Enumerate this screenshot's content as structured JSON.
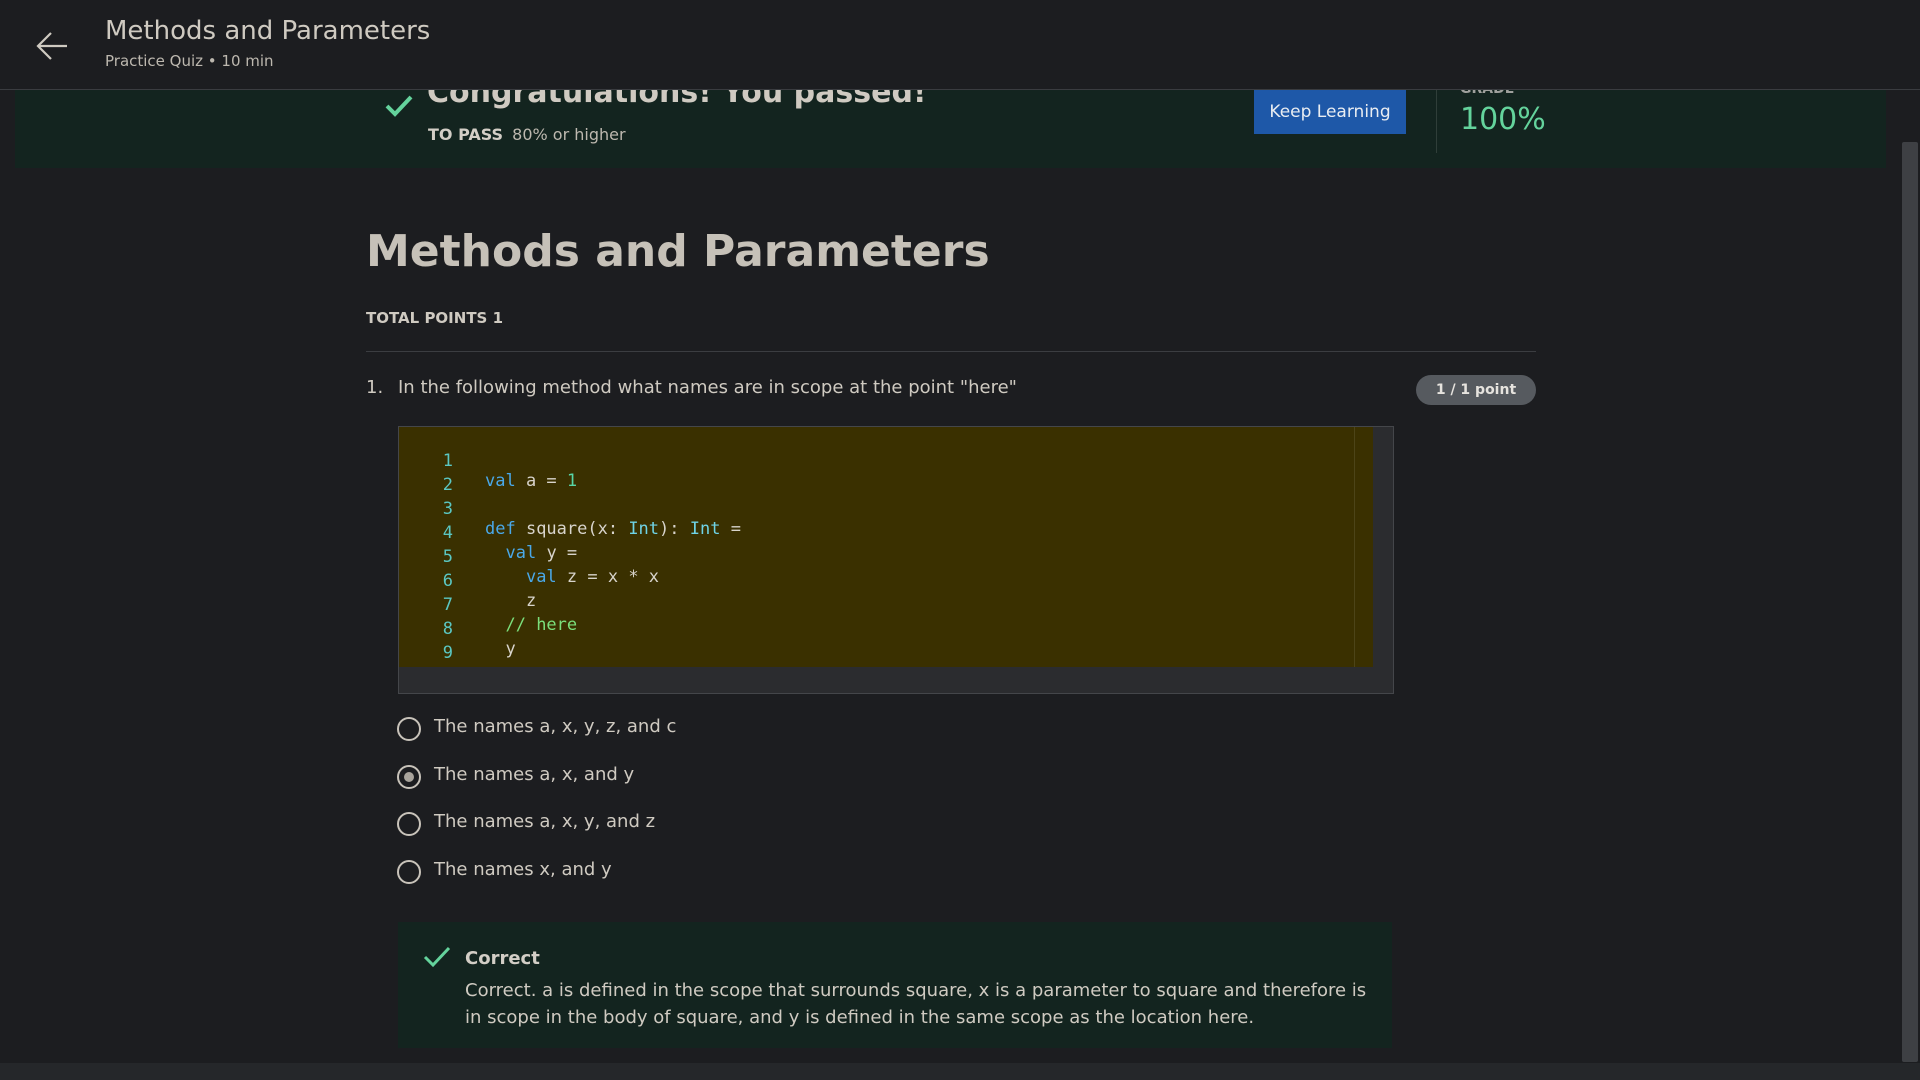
{
  "header": {
    "title": "Methods and Parameters",
    "subtitle": "Practice Quiz • 10 min",
    "back_icon": "arrow-left-icon"
  },
  "banner": {
    "message": "Congratulations! You passed!",
    "to_pass_label": "TO PASS",
    "to_pass_value": "80% or higher",
    "keep_learning_label": "Keep Learning",
    "grade_label": "GRADE",
    "grade_value": "100%",
    "check_icon": "check-icon",
    "colors": {
      "accent_green": "#64d39c",
      "banner_bg": "#13241f",
      "button_blue": "#1e58a8"
    }
  },
  "main": {
    "title": "Methods and Parameters",
    "total_points": "TOTAL POINTS 1"
  },
  "question": {
    "number": "1.",
    "text": "In the following method what names are in scope at the point \"here\"",
    "points": "1 / 1 point",
    "code_lines": [
      "val a = 1",
      "",
      "def square(x: Int): Int =",
      "  val y =",
      "    val z = x * x",
      "    z",
      "  // here",
      "  y",
      ""
    ],
    "line_numbers": [
      "1",
      "2",
      "3",
      "4",
      "5",
      "6",
      "7",
      "8",
      "9"
    ],
    "options": [
      {
        "label": "The names a, x, y, z, and c",
        "selected": false
      },
      {
        "label": "The names a, x, and y",
        "selected": true
      },
      {
        "label": "The names a, x, y, and z",
        "selected": false
      },
      {
        "label": "The names x, and y",
        "selected": false
      }
    ]
  },
  "feedback": {
    "title": "Correct",
    "text": "Correct. a is defined in the scope that surrounds square, x is a parameter to square and therefore is in scope in the body of square, and y is defined in the same scope as the location here."
  }
}
